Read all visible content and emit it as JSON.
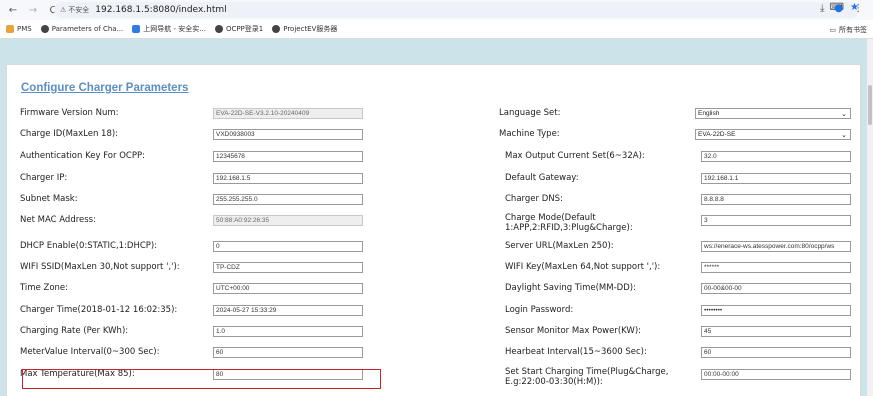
{
  "browser": {
    "insecure_label": "不安全",
    "url": "192.168.1.5:8080/index.html"
  },
  "bookmarks": {
    "items": [
      {
        "label": "PMS",
        "icon": "image-icon",
        "color": "#e8a33c"
      },
      {
        "label": "Parameters of Cha...",
        "icon": "globe-icon",
        "color": "#444444"
      },
      {
        "label": "上网导航 - 安全实...",
        "icon": "shield-icon",
        "color": "#2f7de1"
      },
      {
        "label": "OCPP登录1",
        "icon": "globe-icon",
        "color": "#444444"
      },
      {
        "label": "ProjectEV服务器",
        "icon": "globe-icon",
        "color": "#444444"
      }
    ],
    "all_bookmarks_label": "所有书签"
  },
  "form": {
    "title": "Configure Charger Parameters",
    "left": [
      {
        "label": "Firmware Version Num:",
        "value": "EVA-22D-SE-V3.2.10-20240409",
        "readonly": true
      },
      {
        "label": "Charge ID(MaxLen 18):",
        "value": "VXD0938003"
      },
      {
        "label": "Authentication Key For OCPP:",
        "value": "12345678"
      },
      {
        "label": "Charger IP:",
        "value": "192.168.1.5"
      },
      {
        "label": "Subnet Mask:",
        "value": "255.255.255.0"
      },
      {
        "label": "Net MAC Address:",
        "value": "50:88:A0:92:26:35",
        "readonly": true
      },
      {
        "label": "DHCP Enable(0:STATIC,1:DHCP):",
        "value": "0"
      },
      {
        "label": "WIFI SSID(MaxLen 30,Not support ','):",
        "value": "TP-CDZ"
      },
      {
        "label": "Time Zone:",
        "value": "UTC+00:00"
      },
      {
        "label": "Charger Time(2018-01-12 16:02:35):",
        "value": "2024-05-27 15:33:29"
      },
      {
        "label": "Charging Rate (Per KWh):",
        "value": "1.0"
      },
      {
        "label": "MeterValue Interval(0~300 Sec):",
        "value": "60"
      },
      {
        "label": "Max Temperature(Max 85):",
        "value": "80"
      }
    ],
    "right": [
      {
        "label": "Language Set:",
        "value": "English",
        "select": true
      },
      {
        "label": "Machine Type:",
        "value": "EVA-22D-SE",
        "select": true
      },
      {
        "label": "Max Output Current Set(6~32A):",
        "value": "32.0"
      },
      {
        "label": "Default Gateway:",
        "value": "192.168.1.1"
      },
      {
        "label": "Charger DNS:",
        "value": "8.8.8.8"
      },
      {
        "label": "Charge Mode(Default\n1:APP,2:RFID,3:Plug&Charge):",
        "value": "3"
      },
      {
        "label": "Server URL(MaxLen 250):",
        "value": "ws://enerace-ws.atesspower.com:80/ocpp/ws"
      },
      {
        "label": "WIFI Key(MaxLen 64,Not support ','):",
        "value": "******"
      },
      {
        "label": "Daylight Saving Time(MM-DD):",
        "value": "00-00&00-00"
      },
      {
        "label": "Login Password:",
        "value": "••••••••"
      },
      {
        "label": "Sensor Monitor Max Power(KW):",
        "value": "45"
      },
      {
        "label": "Hearbeat Interval(15~3600 Sec):",
        "value": "60"
      },
      {
        "label": "Set Start Charging Time(Plug&Charge,\nE.g:22:00-03:30(H:M)):",
        "value": "00:00-00:00"
      }
    ]
  }
}
